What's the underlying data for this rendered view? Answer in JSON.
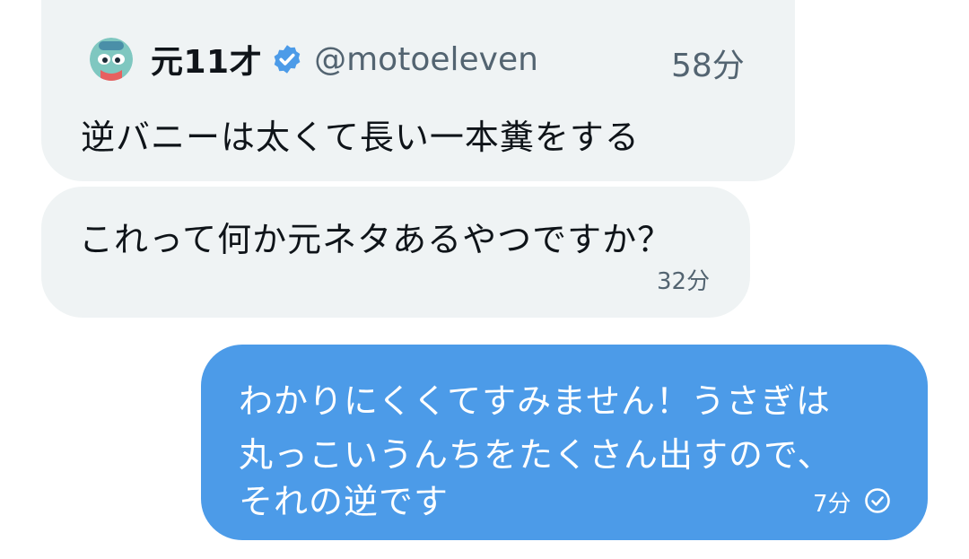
{
  "quoted_post": {
    "author_name": "元11才",
    "author_handle": "@motoeleven",
    "time": "58分",
    "text": "逆バニーは太くて長い一本糞をする",
    "avatar_icon": "cartoon-face-avatar",
    "verified_icon": "verified-badge-icon"
  },
  "incoming_message": {
    "text": "これって何か元ネタあるやつですか？",
    "time": "32分"
  },
  "outgoing_message": {
    "lines": [
      "わかりにくくてすみません！うさぎは",
      "丸っこいうんちをたくさん出すので、",
      "それの逆です"
    ],
    "time": "7分",
    "status_icon": "read-check-icon"
  },
  "colors": {
    "incoming_bubble": "#eff3f4",
    "outgoing_bubble": "#4c9be8",
    "verified_blue": "#4c9be8",
    "primary_text": "#0f1419",
    "secondary_text": "#536471"
  }
}
